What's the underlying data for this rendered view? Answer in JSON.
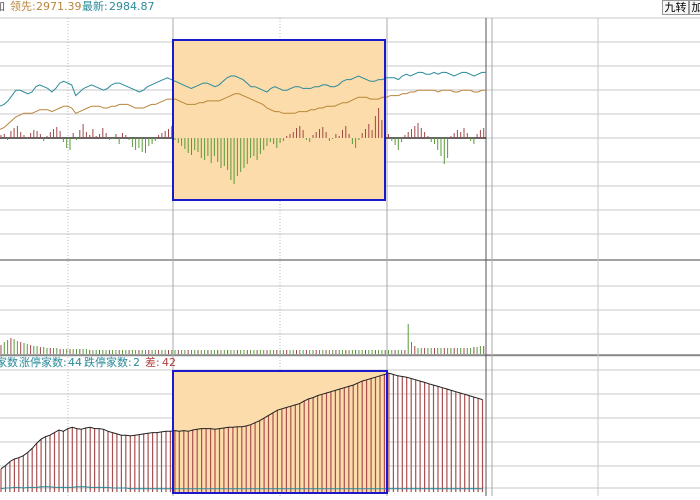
{
  "topbar": {
    "cut_label": "加",
    "lead_label": "领先:",
    "lead_value": "2971.39",
    "latest_label": "最新:",
    "latest_value": "2984.87",
    "btn_nine": "九转",
    "btn_add": "加"
  },
  "stats": {
    "cut_label": "家数",
    "limitup_label": "涨停家数:",
    "limitup_value": "44",
    "limitdown_label": "跌停家数:",
    "limitdown_value": "2",
    "diff_label": "差:",
    "diff_value": "42"
  },
  "colors": {
    "latest_line": "#2a8a9a",
    "lead_line": "#b8863a",
    "up_bar": "#a04848",
    "down_bar": "#5a9a3a",
    "highlight_fill": "#fcdcaa",
    "highlight_border": "#1a1acc",
    "grid": "#c8c8c8"
  },
  "chart_data": [
    {
      "type": "line",
      "panel": "price",
      "series": [
        {
          "name": "最新",
          "values": [
            2984,
            2985,
            2987,
            2990,
            2993,
            2993,
            2992,
            2991,
            2992,
            2995,
            2996,
            2995,
            2994,
            2992,
            2994,
            2997,
            2998,
            2997,
            2996,
            2990,
            2992,
            2994,
            2995,
            2996,
            2995,
            2994,
            2993,
            2994,
            2996,
            2997,
            2997,
            2996,
            2995,
            2994,
            2993,
            2992,
            2993,
            2995,
            2996,
            2997,
            2998,
            2999,
            3000,
            2999,
            2998,
            2997,
            2996,
            2995,
            2994,
            2995,
            2996,
            2997,
            2997,
            2996,
            2995,
            2996,
            2998,
            3000,
            3001,
            3001,
            3000,
            2999,
            2997,
            2995,
            2995,
            2994,
            2993,
            2992,
            2994,
            2995,
            2994,
            2993,
            2993,
            2994,
            2995,
            2995,
            2994,
            2994,
            2994,
            2995,
            2995,
            2996,
            2996,
            2995,
            2995,
            2996,
            2998,
            2999,
            2999,
            3000,
            3001,
            3000,
            2999,
            2998,
            2998,
            2999,
            2999,
            3000,
            3000,
            3000,
            2999,
            3001,
            3002,
            3001,
            3002,
            3003,
            3003,
            3002,
            3002,
            3003,
            3002,
            3003,
            3003,
            3002,
            3001,
            3002,
            3003,
            3003,
            3002,
            3001,
            3002,
            3003,
            3003
          ]
        },
        {
          "name": "领先",
          "values": [
            2971,
            2972,
            2974,
            2976,
            2978,
            2979,
            2980,
            2980,
            2980,
            2981,
            2982,
            2982,
            2982,
            2981,
            2982,
            2983,
            2984,
            2984,
            2983,
            2980,
            2981,
            2982,
            2983,
            2984,
            2984,
            2984,
            2983,
            2983,
            2984,
            2984,
            2985,
            2985,
            2985,
            2984,
            2983,
            2983,
            2983,
            2984,
            2985,
            2985,
            2986,
            2987,
            2988,
            2988,
            2988,
            2987,
            2986,
            2985,
            2985,
            2985,
            2986,
            2986,
            2987,
            2987,
            2987,
            2987,
            2988,
            2989,
            2990,
            2991,
            2991,
            2990,
            2989,
            2988,
            2987,
            2986,
            2985,
            2983,
            2982,
            2981,
            2981,
            2980,
            2980,
            2980,
            2980,
            2981,
            2981,
            2981,
            2982,
            2982,
            2983,
            2983,
            2984,
            2984,
            2984,
            2985,
            2986,
            2986,
            2987,
            2988,
            2989,
            2989,
            2989,
            2988,
            2988,
            2988,
            2989,
            2989,
            2990,
            2990,
            2990,
            2991,
            2991,
            2992,
            2992,
            2993,
            2993,
            2993,
            2993,
            2993,
            2992,
            2993,
            2993,
            2993,
            2992,
            2992,
            2993,
            2993,
            2993,
            2992,
            2992,
            2993,
            2993
          ]
        }
      ],
      "bars": [
        3,
        4,
        -2,
        7,
        10,
        12,
        6,
        3,
        -1,
        5,
        8,
        7,
        4,
        -3,
        2,
        6,
        9,
        11,
        7,
        -4,
        -10,
        -12,
        5,
        -2,
        8,
        14,
        6,
        3,
        9,
        2,
        4,
        10,
        5,
        -2,
        -1,
        4,
        -6,
        5,
        3,
        -2,
        -9,
        -12,
        -10,
        -14,
        -15,
        -8,
        -6,
        -3,
        3,
        5,
        7,
        9,
        12,
        -2,
        -5,
        -8,
        -11,
        -15,
        -17,
        -12,
        -14,
        -20,
        -22,
        -18,
        -25,
        -18,
        -24,
        -30,
        -28,
        -32,
        -42,
        -46,
        -38,
        -34,
        -30,
        -26,
        -20,
        -18,
        -22,
        -16,
        -12,
        -8,
        -4,
        -6,
        -10,
        -5,
        -3,
        2,
        4,
        6,
        10,
        12,
        8,
        -2,
        -4,
        3,
        6,
        9,
        11,
        6,
        -3,
        -1,
        4,
        2,
        8,
        12,
        4,
        -6,
        -10,
        -2,
        5,
        9,
        14,
        8,
        22,
        30,
        18,
        10,
        4,
        -3,
        -7,
        -12,
        -4,
        3,
        6,
        9,
        12,
        15,
        10,
        6,
        2,
        -4,
        -6,
        -12,
        -18,
        -26,
        -20,
        2,
        5,
        8,
        6,
        10,
        5,
        -3,
        -6,
        4,
        8,
        10
      ]
    },
    {
      "type": "bar",
      "panel": "volume",
      "values": [
        9,
        12,
        14,
        16,
        15,
        13,
        12,
        11,
        10,
        9,
        8,
        8,
        7,
        7,
        6,
        6,
        6,
        6,
        5,
        5,
        5,
        5,
        5,
        5,
        5,
        5,
        5,
        4,
        4,
        4,
        4,
        4,
        4,
        4,
        4,
        4,
        4,
        4,
        4,
        4,
        4,
        4,
        4,
        4,
        4,
        4,
        4,
        4,
        4,
        4,
        4,
        4,
        4,
        4,
        4,
        4,
        4,
        4,
        4,
        4,
        4,
        4,
        4,
        4,
        4,
        4,
        4,
        4,
        4,
        4,
        4,
        4,
        4,
        4,
        4,
        4,
        4,
        4,
        4,
        4,
        4,
        4,
        4,
        4,
        4,
        4,
        4,
        4,
        4,
        4,
        4,
        4,
        4,
        4,
        4,
        4,
        4,
        4,
        4,
        4,
        4,
        4,
        4,
        4,
        4,
        4,
        4,
        4,
        4,
        4,
        4,
        4,
        4,
        4,
        4,
        4,
        4,
        4,
        4,
        4,
        4,
        4,
        4,
        4,
        30,
        12,
        8,
        6,
        6,
        6,
        6,
        6,
        6,
        6,
        6,
        6,
        6,
        6,
        6,
        6,
        6,
        6,
        6,
        6,
        7,
        7,
        8,
        8
      ]
    },
    {
      "type": "bar",
      "panel": "breadth",
      "series": [
        {
          "name": "涨停家数",
          "values": [
            35,
            40,
            46,
            50,
            52,
            55,
            60,
            66,
            74,
            80,
            84,
            86,
            90,
            94,
            92,
            96,
            98,
            96,
            95,
            97,
            98,
            96,
            96,
            95,
            92,
            90,
            88,
            86,
            86,
            85,
            86,
            87,
            88,
            89,
            90,
            90,
            91,
            92,
            92,
            93,
            92,
            93,
            92,
            94,
            95,
            96,
            96,
            96,
            95,
            96,
            97,
            98,
            98,
            99,
            99,
            100,
            102,
            105,
            108,
            112,
            116,
            120,
            124,
            126,
            128,
            130,
            132,
            134,
            138,
            141,
            143,
            146,
            148,
            150,
            152,
            154,
            156,
            158,
            160,
            162,
            165,
            168,
            170,
            172,
            174,
            176,
            178,
            180,
            178,
            176,
            175,
            174,
            172,
            170,
            168,
            166,
            164,
            162,
            160,
            158,
            156,
            154,
            152,
            150,
            148,
            146,
            144,
            142,
            140
          ]
        },
        {
          "name": "跌停家数",
          "values": [
            2,
            3,
            3,
            4,
            4,
            3,
            4,
            4,
            4,
            5,
            5,
            5,
            4,
            4,
            4,
            4,
            4,
            5,
            5,
            5,
            4,
            4,
            4,
            4,
            4,
            3,
            3,
            3,
            3,
            2,
            2,
            2,
            2,
            2,
            2,
            2,
            2,
            2,
            2,
            2,
            2,
            2,
            2,
            2,
            2,
            2,
            2,
            2,
            2,
            2,
            2,
            2,
            2,
            2,
            2,
            2,
            2,
            2,
            2,
            2,
            2,
            2,
            2,
            2,
            2,
            2,
            2,
            2,
            2,
            2,
            2,
            2,
            2,
            2,
            2,
            2,
            2,
            2,
            2,
            2,
            2,
            2,
            2,
            2,
            2,
            2,
            2,
            2,
            2,
            2,
            2,
            2,
            2,
            2,
            2,
            2,
            2,
            2,
            2,
            2,
            2,
            2,
            2,
            2,
            2,
            2,
            2,
            2,
            2
          ]
        }
      ]
    }
  ]
}
